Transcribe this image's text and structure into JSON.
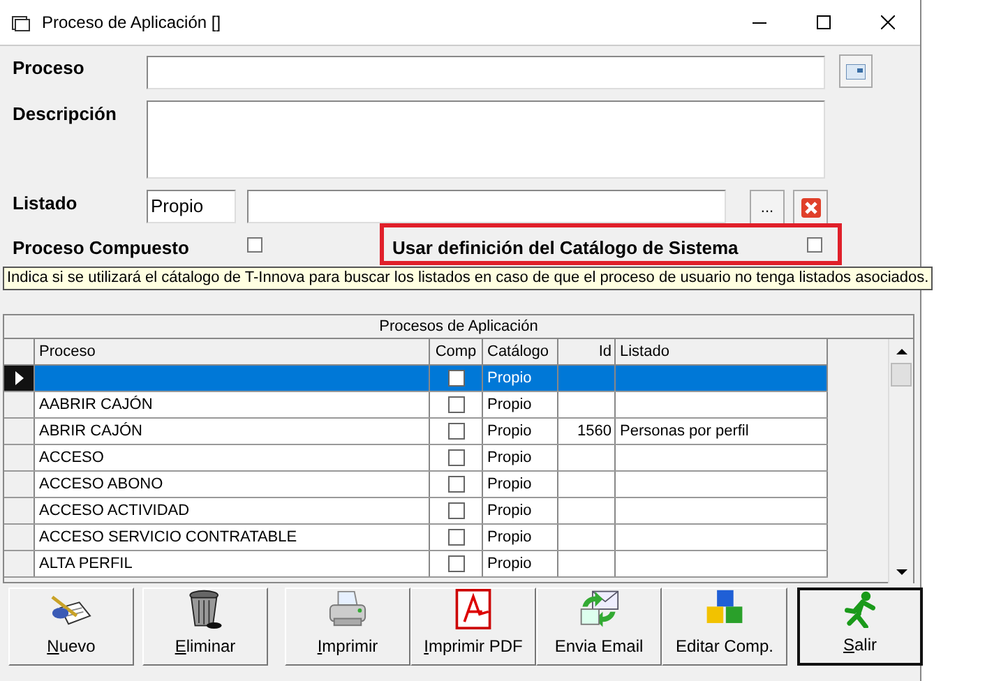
{
  "window": {
    "title": "Proceso de Aplicación []"
  },
  "form": {
    "proceso_label": "Proceso",
    "descripcion_label": "Descripción",
    "listado_label": "Listado",
    "listado_catalog_value": "Propio",
    "listado_browse": "...",
    "compuesto_label": "Proceso Compuesto",
    "compuesto_checked": false,
    "catalogo_label": "Usar definición del Catálogo de Sistema",
    "catalogo_checked": false
  },
  "tooltip": "Indica si se utilizará el cátalogo de T-Innova para buscar los listados en caso de que el proceso de usuario no tenga listados asociados.",
  "table": {
    "caption": "Procesos de Aplicación",
    "columns": [
      "Proceso",
      "Comp",
      "Catálogo",
      "Id",
      "Listado"
    ],
    "rows": [
      {
        "selected": true,
        "proceso": "",
        "comp": false,
        "catalogo": "Propio",
        "id": "",
        "listado": ""
      },
      {
        "selected": false,
        "proceso": "AABRIR CAJÓN",
        "comp": false,
        "catalogo": "Propio",
        "id": "",
        "listado": ""
      },
      {
        "selected": false,
        "proceso": "ABRIR CAJÓN",
        "comp": false,
        "catalogo": "Propio",
        "id": "1560",
        "listado": "Personas por perfil"
      },
      {
        "selected": false,
        "proceso": "ACCESO",
        "comp": false,
        "catalogo": "Propio",
        "id": "",
        "listado": ""
      },
      {
        "selected": false,
        "proceso": "ACCESO ABONO",
        "comp": false,
        "catalogo": "Propio",
        "id": "",
        "listado": ""
      },
      {
        "selected": false,
        "proceso": "ACCESO ACTIVIDAD",
        "comp": false,
        "catalogo": "Propio",
        "id": "",
        "listado": ""
      },
      {
        "selected": false,
        "proceso": "ACCESO SERVICIO CONTRATABLE",
        "comp": false,
        "catalogo": "Propio",
        "id": "",
        "listado": ""
      },
      {
        "selected": false,
        "proceso": "ALTA PERFIL",
        "comp": false,
        "catalogo": "Propio",
        "id": "",
        "listado": ""
      }
    ]
  },
  "buttons": [
    {
      "kind": "new",
      "label": "Nuevo",
      "mnemonic": true,
      "default": false
    },
    {
      "kind": "delete",
      "label": "Eliminar",
      "mnemonic": true,
      "default": false
    },
    {
      "kind": "print",
      "label": "Imprimir",
      "mnemonic": true,
      "default": false
    },
    {
      "kind": "pdf",
      "label": "Imprimir PDF",
      "mnemonic": true,
      "default": false
    },
    {
      "kind": "email",
      "label": "Envia Email",
      "mnemonic": false,
      "default": false
    },
    {
      "kind": "edit",
      "label": "Editar Comp.",
      "mnemonic": false,
      "default": false
    },
    {
      "kind": "exit",
      "label": "Salir",
      "mnemonic": true,
      "default": true
    }
  ]
}
